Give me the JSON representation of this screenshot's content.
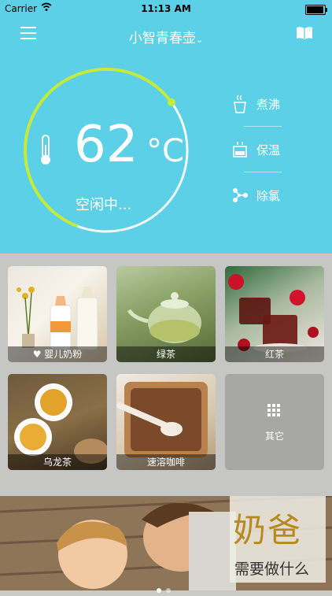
{
  "status_bar": {
    "carrier": "Carrier",
    "time": "11:13 AM",
    "battery_level": 0.95
  },
  "nav": {
    "title": "小智青春壶",
    "title_chevron": "chevron-down-icon",
    "menu_icon": "menu-icon",
    "book_icon": "book-icon"
  },
  "kettle": {
    "temperature": "62",
    "unit": "°C",
    "status": "空闲中...",
    "gauge_level": 0.62,
    "colors": {
      "background": "#5cd0e6",
      "arc": "#c4ea3c"
    }
  },
  "modes": [
    {
      "label": "煮沸",
      "icon": "boil-icon"
    },
    {
      "label": "保温",
      "icon": "keep-warm-icon"
    },
    {
      "label": "除氯",
      "icon": "dechlorinate-icon"
    }
  ],
  "drinks": [
    {
      "label": "婴儿奶粉",
      "icon": "heart-icon"
    },
    {
      "label": "绿茶"
    },
    {
      "label": "红茶"
    },
    {
      "label": "乌龙茶"
    },
    {
      "label": "速溶咖啡"
    },
    {
      "label": "其它",
      "icon": "grid-icon"
    }
  ],
  "banner": {
    "headline": "奶爸",
    "subline": "需要做什么",
    "pages": 2,
    "current_page": 1
  }
}
